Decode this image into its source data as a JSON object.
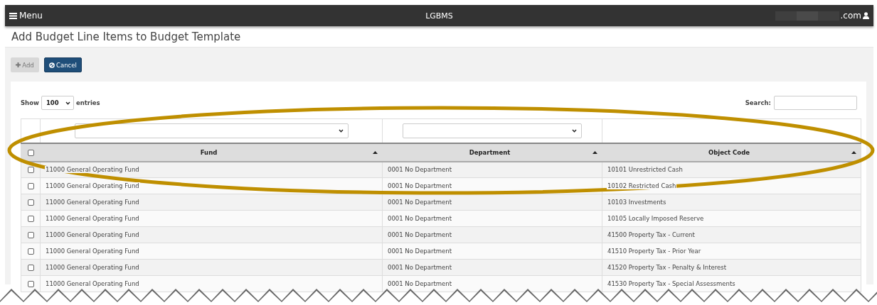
{
  "navbar": {
    "menu_label": "Menu",
    "title": "LGBMS",
    "user": ".com"
  },
  "page_title": "Add Budget Line Items to Budget Template",
  "toolbar": [
    {
      "kind": "add",
      "label": "Add",
      "disabled": true
    },
    {
      "kind": "cancel",
      "label": "Cancel",
      "disabled": false
    }
  ],
  "length_menu": {
    "prefix": "Show",
    "value": "100",
    "suffix": "entries"
  },
  "search": {
    "label": "Search:"
  },
  "table": {
    "select_all_checked": false,
    "columns": [
      {
        "label": "Fund",
        "filter": true
      },
      {
        "label": "Department",
        "filter": true
      },
      {
        "label": "Object Code",
        "filter": false
      }
    ],
    "rows": [
      {
        "checked": false,
        "cells": [
          "11000 General Operating Fund",
          "0001 No Department",
          "10101 Unrestricted Cash"
        ]
      },
      {
        "checked": false,
        "cells": [
          "11000 General Operating Fund",
          "0001 No Department",
          "10102 Restricted Cash"
        ]
      },
      {
        "checked": false,
        "cells": [
          "11000 General Operating Fund",
          "0001 No Department",
          "10103 Investments"
        ]
      },
      {
        "checked": false,
        "cells": [
          "11000 General Operating Fund",
          "0001 No Department",
          "10105 Locally Imposed Reserve"
        ]
      },
      {
        "checked": false,
        "cells": [
          "11000 General Operating Fund",
          "0001 No Department",
          "41500 Property Tax - Current"
        ]
      },
      {
        "checked": false,
        "cells": [
          "11000 General Operating Fund",
          "0001 No Department",
          "41510 Property Tax - Prior Year"
        ]
      },
      {
        "checked": false,
        "cells": [
          "11000 General Operating Fund",
          "0001 No Department",
          "41520 Property Tax - Penalty & Interest"
        ]
      },
      {
        "checked": false,
        "cells": [
          "11000 General Operating Fund",
          "0001 No Department",
          "41530 Property Tax - Special Assessments"
        ]
      }
    ]
  }
}
